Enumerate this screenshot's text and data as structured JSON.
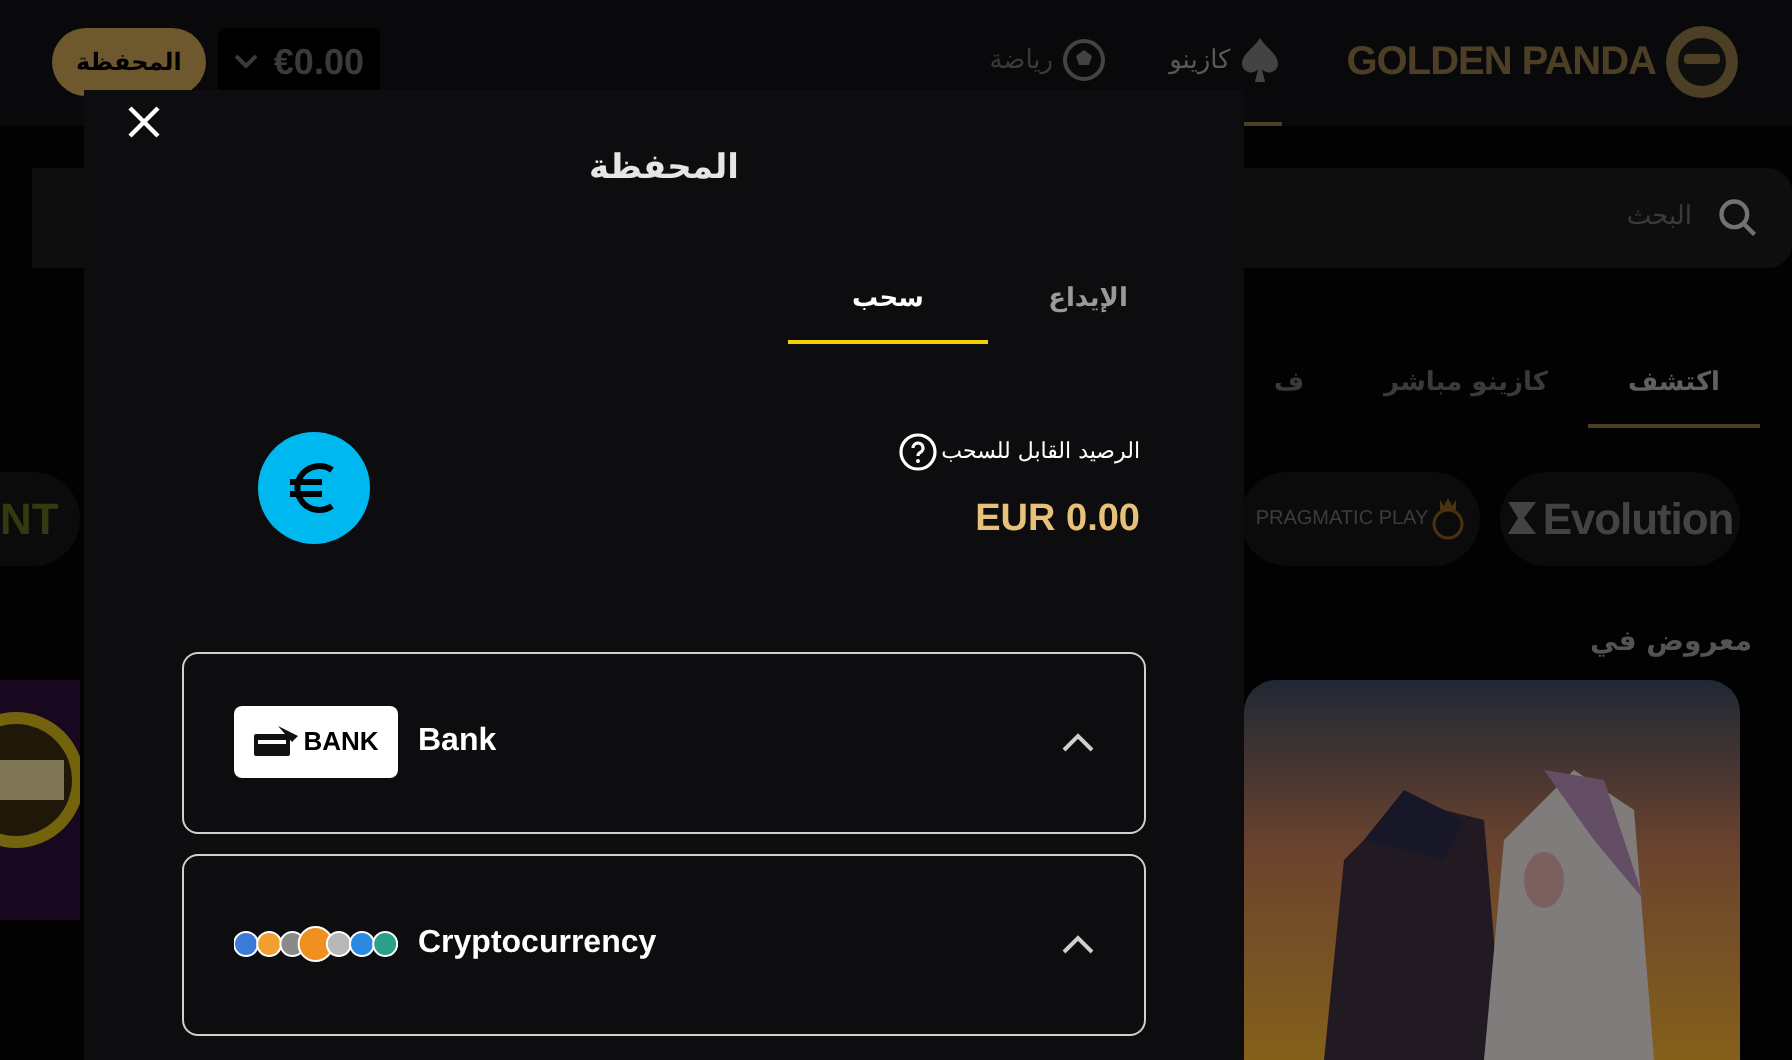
{
  "header": {
    "logo_text": "GOLDEN PANDA",
    "nav": [
      {
        "label": "كازينو",
        "selected": true,
        "kind": "spade"
      },
      {
        "label": "رياضة",
        "selected": false,
        "kind": "ball"
      }
    ],
    "balance": "€0.00",
    "wallet_button": "المحفظة"
  },
  "search": {
    "placeholder": "البحث"
  },
  "categories": [
    {
      "label": "اكتشف",
      "selected": true
    },
    {
      "label": "كازينو مباشر",
      "selected": false
    },
    {
      "label": "ف",
      "selected": false
    }
  ],
  "providers": [
    {
      "kind": "evolution",
      "label": "Evolution"
    },
    {
      "kind": "pragmatic",
      "label": "PRAGMATIC PLAY"
    },
    {
      "kind": "plain",
      "label": "NT"
    }
  ],
  "section_title": "معروض في",
  "modal": {
    "title": "المحفظة",
    "tabs": [
      {
        "label": "الإيداع",
        "selected": false
      },
      {
        "label": "سحب",
        "selected": true
      }
    ],
    "balance_label": "الرصيد القابل للسحب",
    "balance": "EUR 0.00",
    "methods": [
      {
        "kind": "bank",
        "logo_text": "BANK",
        "name": "Bank"
      },
      {
        "kind": "crypto",
        "name": "Cryptocurrency"
      }
    ]
  }
}
